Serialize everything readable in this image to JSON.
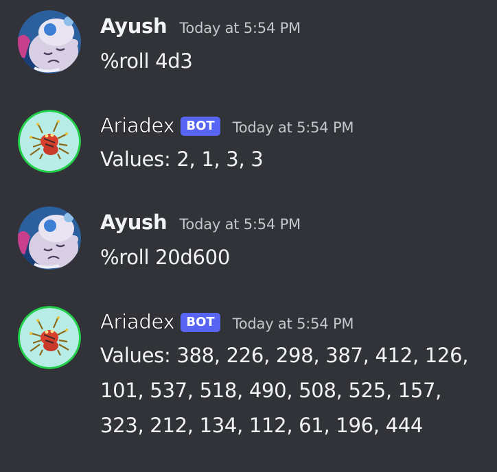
{
  "messages": [
    {
      "author": "Ayush",
      "is_bot": false,
      "timestamp": "Today at 5:54 PM",
      "content": "%roll 4d3",
      "avatar_icon": "mascot-avatar-icon"
    },
    {
      "author": "Ariadex",
      "is_bot": true,
      "bot_tag": "BOT",
      "timestamp": "Today at 5:54 PM",
      "content": "Values: 2, 1, 3, 3",
      "avatar_icon": "spider-bot-avatar-icon"
    },
    {
      "author": "Ayush",
      "is_bot": false,
      "timestamp": "Today at 5:54 PM",
      "content": "%roll 20d600",
      "avatar_icon": "mascot-avatar-icon"
    },
    {
      "author": "Ariadex",
      "is_bot": true,
      "bot_tag": "BOT",
      "timestamp": "Today at 5:54 PM",
      "content": "Values: 388, 226, 298, 387, 412, 126, 101, 537, 518, 490, 508, 525, 157, 323, 212, 134, 112, 61, 196, 444",
      "avatar_icon": "spider-bot-avatar-icon"
    }
  ],
  "colors": {
    "background": "#313338",
    "text": "#f2f3f5",
    "timestamp": "#c4c7cc",
    "bot_tag": "#5865f2",
    "bot_avatar_ring": "#23d04a",
    "bot_avatar_bg": "#b8ece6"
  }
}
